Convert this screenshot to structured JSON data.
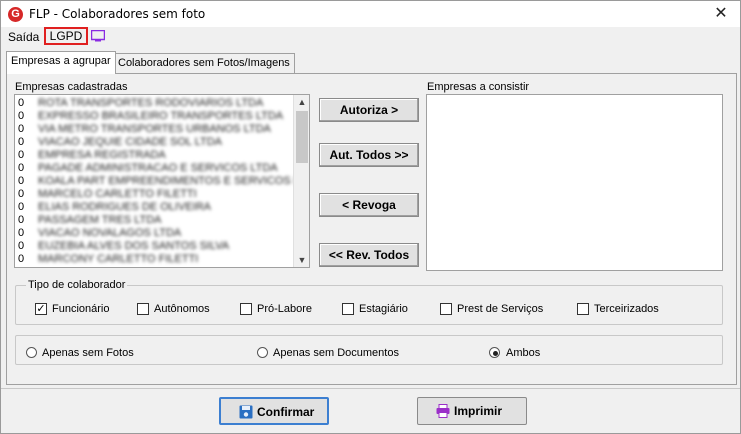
{
  "window": {
    "title": "FLP - Colaboradores sem foto",
    "close": "✕",
    "app_icon_letter": "G"
  },
  "menu": {
    "saida": "Saída",
    "lgpd": "LGPD",
    "monitor_icon": "monitor-icon"
  },
  "tabs": [
    {
      "label": "Empresas a agrupar",
      "active": true
    },
    {
      "label": "Colaboradores sem Fotos/Imagens",
      "active": false
    }
  ],
  "left_list": {
    "label": "Empresas cadastradas",
    "items": [
      {
        "code": "0",
        "name": "ROTA TRANSPORTES RODOVIARIOS LTDA"
      },
      {
        "code": "0",
        "name": "EXPRESSO BRASILEIRO TRANSPORTES LTDA"
      },
      {
        "code": "0",
        "name": "VIA METRO TRANSPORTES URBANOS LTDA"
      },
      {
        "code": "0",
        "name": "VIACAO JEQUIE CIDADE SOL LTDA"
      },
      {
        "code": "0",
        "name": "EMPRESA REGISTRADA"
      },
      {
        "code": "0",
        "name": "PAGADE ADMINISTRACAO E SERVICOS LTDA"
      },
      {
        "code": "0",
        "name": "KOALA PART EMPREENDIMENTOS E SERVICOS LTDA"
      },
      {
        "code": "0",
        "name": "MARCELO CARLETTO FILETTI"
      },
      {
        "code": "0",
        "name": "ELIAS RODRIGUES DE OLIVEIRA"
      },
      {
        "code": "0",
        "name": "PASSAGEM TRES LTDA"
      },
      {
        "code": "0",
        "name": "VIACAO NOVALAGOS LTDA"
      },
      {
        "code": "0",
        "name": "EUZEBIA ALVES DOS SANTOS SILVA"
      },
      {
        "code": "0",
        "name": "MARCONY CARLETTO FILETTI"
      }
    ]
  },
  "right_list": {
    "label": "Empresas a consistir"
  },
  "transfer_buttons": {
    "autoriza": "Autoriza >",
    "aut_todos": "Aut. Todos >>",
    "revoga": "< Revoga",
    "rev_todos": "<< Rev. Todos"
  },
  "tipo_colaborador": {
    "title": "Tipo de colaborador",
    "options": [
      {
        "label": "Funcionário",
        "checked": true
      },
      {
        "label": "Autônomos",
        "checked": false
      },
      {
        "label": "Pró-Labore",
        "checked": false
      },
      {
        "label": "Estagiário",
        "checked": false
      },
      {
        "label": "Prest de Serviços",
        "checked": false
      },
      {
        "label": "Terceirizados",
        "checked": false
      }
    ]
  },
  "filter_radios": {
    "options": [
      {
        "label": "Apenas sem Fotos",
        "selected": false
      },
      {
        "label": "Apenas sem Documentos",
        "selected": false
      },
      {
        "label": "Ambos",
        "selected": true
      }
    ]
  },
  "footer": {
    "confirmar": "Confirmar",
    "imprimir": "Imprimir",
    "confirmar_icon": "save-icon",
    "imprimir_icon": "printer-icon"
  },
  "colors": {
    "lgpd_border": "#e02020",
    "focus_border": "#3c7fd1",
    "app_icon": "#d62828",
    "printer": "#9b2fc9",
    "save": "#2a6fc2"
  }
}
